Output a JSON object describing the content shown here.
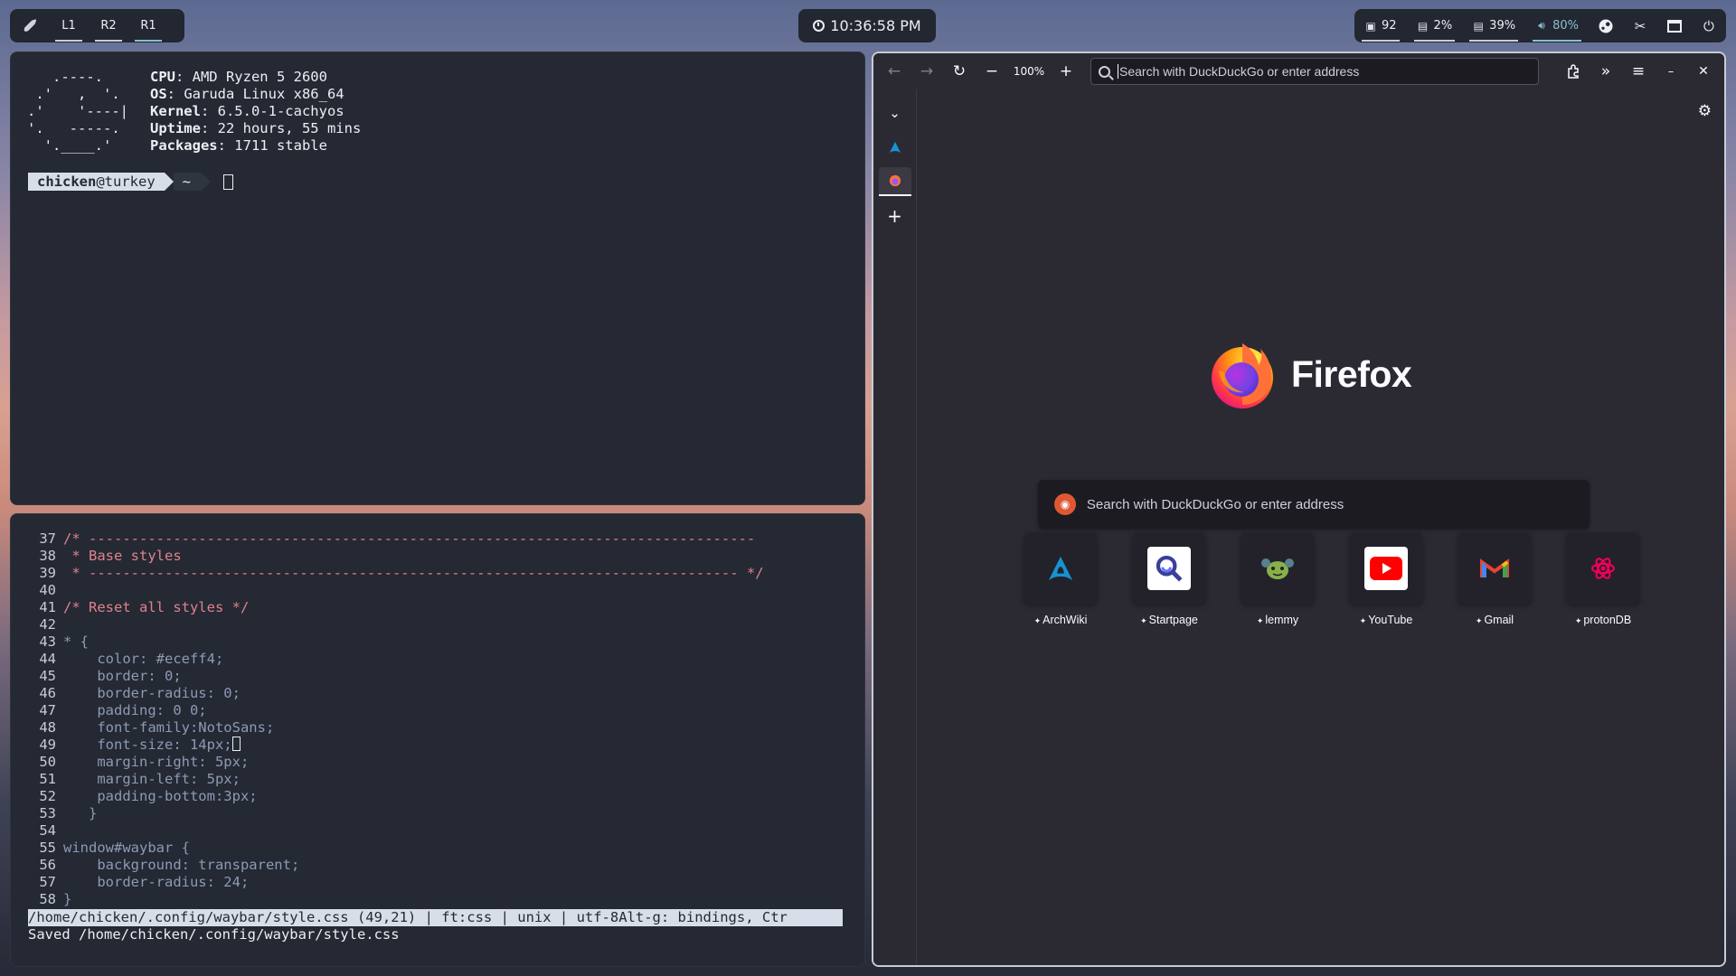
{
  "waybar": {
    "workspaces": [
      "L1",
      "R2",
      "R1"
    ],
    "clock": "10:36:58 PM",
    "modules": [
      {
        "icon": "package-icon",
        "value": "92"
      },
      {
        "icon": "cpu-icon",
        "value": "2%"
      },
      {
        "icon": "memory-icon",
        "value": "39%"
      },
      {
        "icon": "volume-icon",
        "value": "80%"
      }
    ]
  },
  "terminal": {
    "ascii_logo": "   .----.\n .'   ,  '.\n.'    '----|\n'.   -----.\n  '.____.'",
    "info": [
      {
        "key": "CPU",
        "value": ": AMD Ryzen 5 2600"
      },
      {
        "key": "OS",
        "value": ": Garuda Linux x86_64"
      },
      {
        "key": "Kernel",
        "value": ": 6.5.0-1-cachyos"
      },
      {
        "key": "Uptime",
        "value": ": 22 hours, 55 mins"
      },
      {
        "key": "Packages",
        "value": ": 1711 stable"
      }
    ],
    "prompt_user": "chicken",
    "prompt_host": "@turkey",
    "prompt_dir": "~"
  },
  "editor": {
    "lines": [
      {
        "n": "37",
        "t": "/* -------------------------------------------------------------------------------",
        "c": "cm"
      },
      {
        "n": "38",
        "t": " * Base styles",
        "c": "cm"
      },
      {
        "n": "39",
        "t": " * ----------------------------------------------------------------------------- */",
        "c": "cm"
      },
      {
        "n": "40",
        "t": "",
        "c": "cd"
      },
      {
        "n": "41",
        "t": "/* Reset all styles */",
        "c": "cm"
      },
      {
        "n": "42",
        "t": "",
        "c": "cd"
      },
      {
        "n": "43",
        "t": "* {",
        "c": "cd"
      },
      {
        "n": "44",
        "t": "    color: #eceff4;",
        "c": "cd"
      },
      {
        "n": "45",
        "t": "    border: 0;",
        "c": "cd"
      },
      {
        "n": "46",
        "t": "    border-radius: 0;",
        "c": "cd"
      },
      {
        "n": "47",
        "t": "    padding: 0 0;",
        "c": "cd"
      },
      {
        "n": "48",
        "t": "    font-family:NotoSans;",
        "c": "cd"
      },
      {
        "n": "49",
        "t": "    font-size: 14px;",
        "c": "cd"
      },
      {
        "n": "50",
        "t": "    margin-right: 5px;",
        "c": "cd"
      },
      {
        "n": "51",
        "t": "    margin-left: 5px;",
        "c": "cd"
      },
      {
        "n": "52",
        "t": "    padding-bottom:3px;",
        "c": "cd"
      },
      {
        "n": "53",
        "t": "   }",
        "c": "cd"
      },
      {
        "n": "54",
        "t": "",
        "c": "cd"
      },
      {
        "n": "55",
        "t": "window#waybar {",
        "c": "cd"
      },
      {
        "n": "56",
        "t": "    background: transparent;",
        "c": "cd"
      },
      {
        "n": "57",
        "t": "    border-radius: 24;",
        "c": "cd"
      },
      {
        "n": "58",
        "t": "}",
        "c": "cd"
      }
    ],
    "status": "/home/chicken/.config/waybar/style.css (49,21) | ft:css | unix | utf-8Alt-g: bindings, Ctr",
    "message": "Saved /home/chicken/.config/waybar/style.css"
  },
  "firefox": {
    "zoom": "100%",
    "url_placeholder": "Search with DuckDuckGo or enter address",
    "wordmark": "Firefox",
    "search_placeholder": "Search with DuckDuckGo or enter address",
    "shortcuts": [
      {
        "label": "ArchWiki",
        "icon": "archwiki-icon"
      },
      {
        "label": "Startpage",
        "icon": "startpage-icon"
      },
      {
        "label": "lemmy",
        "icon": "lemmy-icon"
      },
      {
        "label": "YouTube",
        "icon": "youtube-icon"
      },
      {
        "label": "Gmail",
        "icon": "gmail-icon"
      },
      {
        "label": "protonDB",
        "icon": "protondb-icon"
      }
    ]
  }
}
